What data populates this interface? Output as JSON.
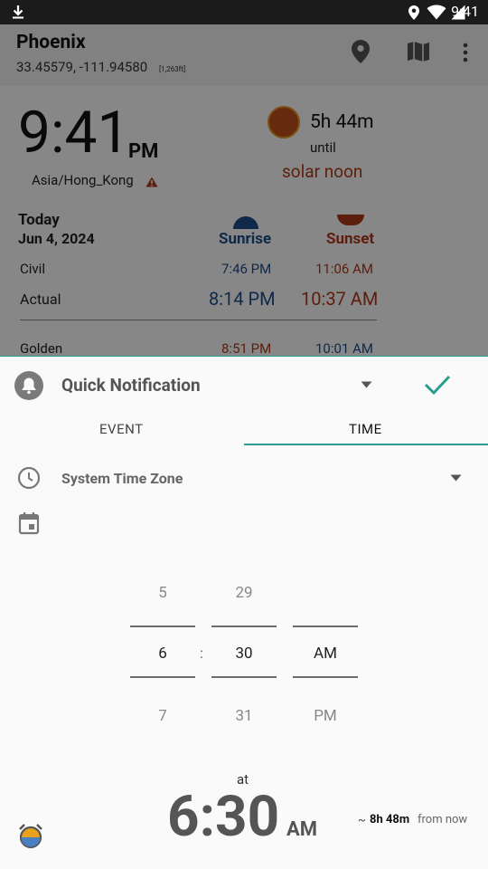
{
  "status_bar": {
    "time": "9:41"
  },
  "app": {
    "location_name": "Phoenix",
    "coordinates": "33.45579, -111.94580",
    "elevation": "[1,263ft]",
    "clock_time": "9:41",
    "clock_ampm": "PM",
    "timezone": "Asia/Hong_Kong",
    "countdown": "5h 44m",
    "until_label": "until",
    "event_label": "solar noon",
    "day_label": "Today",
    "date_label": "Jun 4, 2024",
    "sunrise_header": "Sunrise",
    "sunset_header": "Sunset",
    "rows": [
      {
        "label": "Civil",
        "sunrise": "7:46 PM",
        "sunset": "11:06 AM"
      },
      {
        "label": "Actual",
        "sunrise": "8:14 PM",
        "sunset": "10:37 AM"
      },
      {
        "label": "Golden",
        "sunrise": "8:51 PM",
        "sunset": "10:01 AM"
      }
    ]
  },
  "sheet": {
    "title": "Quick Notification",
    "tabs": [
      {
        "label": "EVENT"
      },
      {
        "label": "TIME"
      }
    ],
    "timezone_label": "System Time Zone",
    "picker": {
      "hour": {
        "prev": "5",
        "current": "6",
        "next": "7"
      },
      "separator": ":",
      "minute": {
        "prev": "29",
        "current": "30",
        "next": "31"
      },
      "ampm": {
        "current": "AM",
        "next": "PM"
      }
    },
    "at_label": "at",
    "big_time": "6:30",
    "big_ampm": "AM",
    "approx": "~",
    "duration": "8h 48m",
    "from_now": "from now"
  },
  "colors": {
    "accent": "#2a9d8f",
    "sunrise_blue": "#1f4e8c",
    "sunset_red": "#b23a1a"
  }
}
